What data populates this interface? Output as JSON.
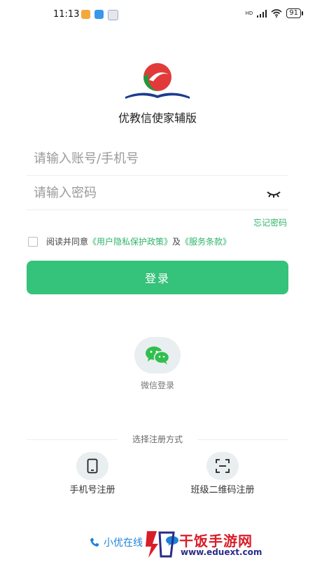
{
  "status_bar": {
    "time": "11:13",
    "signal_label": "HD",
    "battery": "91"
  },
  "app": {
    "title": "优教信使家辅版",
    "logo_icon": "book-logo-icon"
  },
  "form": {
    "account_placeholder": "请输入账号/手机号",
    "password_placeholder": "请输入密码",
    "forgot_password": "忘记密码",
    "agreement_prefix": "阅读并同意",
    "privacy_policy": "《用户隐私保护政策》",
    "agreement_and": "及",
    "service_terms": "《服务条款》",
    "login_button": "登录"
  },
  "wechat": {
    "label": "微信登录"
  },
  "register": {
    "heading": "选择注册方式",
    "phone_register": "手机号注册",
    "qr_register": "班级二维码注册"
  },
  "bottom": {
    "online_help": "小优在线"
  },
  "watermark": {
    "text": "干饭手游网",
    "url": "www.eduext.com"
  },
  "colors": {
    "accent": "#35c27a",
    "link": "#2fb46a",
    "bottom_link": "#1e82d8"
  }
}
